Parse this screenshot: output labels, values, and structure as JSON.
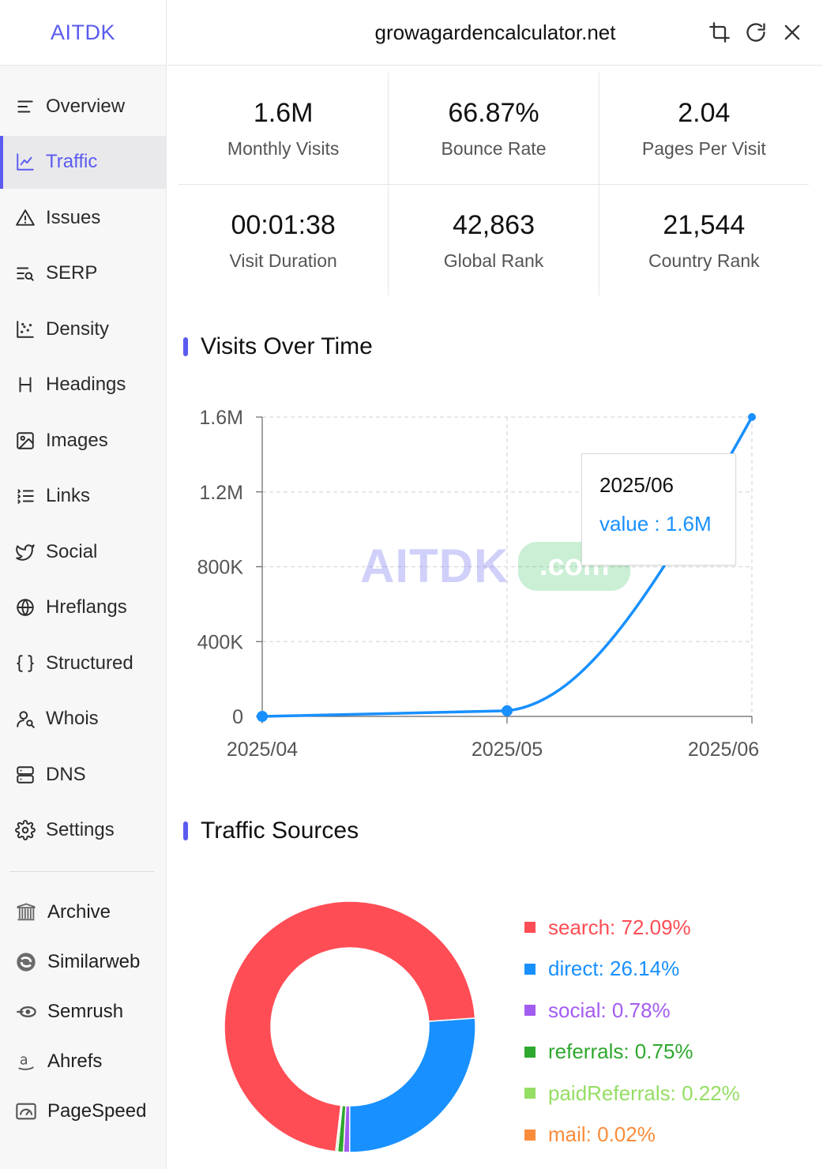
{
  "brand": "AITDK",
  "header": {
    "domain": "growagardencalculator.net"
  },
  "nav": [
    {
      "label": "Overview",
      "icon": "overview-icon"
    },
    {
      "label": "Traffic",
      "icon": "traffic-icon",
      "active": true
    },
    {
      "label": "Issues",
      "icon": "warning-icon"
    },
    {
      "label": "SERP",
      "icon": "serp-icon"
    },
    {
      "label": "Density",
      "icon": "density-icon"
    },
    {
      "label": "Headings",
      "icon": "heading-icon"
    },
    {
      "label": "Images",
      "icon": "image-icon"
    },
    {
      "label": "Links",
      "icon": "links-icon"
    },
    {
      "label": "Social",
      "icon": "twitter-icon"
    },
    {
      "label": "Hreflangs",
      "icon": "globe-icon"
    },
    {
      "label": "Structured",
      "icon": "braces-icon"
    },
    {
      "label": "Whois",
      "icon": "user-search-icon"
    },
    {
      "label": "DNS",
      "icon": "server-icon"
    },
    {
      "label": "Settings",
      "icon": "gear-icon"
    }
  ],
  "external": [
    {
      "label": "Archive",
      "icon": "archive-icon"
    },
    {
      "label": "Similarweb",
      "icon": "similarweb-icon"
    },
    {
      "label": "Semrush",
      "icon": "semrush-icon"
    },
    {
      "label": "Ahrefs",
      "icon": "ahrefs-icon"
    },
    {
      "label": "PageSpeed",
      "icon": "pagespeed-icon"
    }
  ],
  "stats": {
    "monthly_visits": {
      "value": "1.6M",
      "label": "Monthly Visits"
    },
    "bounce_rate": {
      "value": "66.87%",
      "label": "Bounce Rate"
    },
    "pages_per_visit": {
      "value": "2.04",
      "label": "Pages Per Visit"
    },
    "visit_duration": {
      "value": "00:01:38",
      "label": "Visit Duration"
    },
    "global_rank": {
      "value": "42,863",
      "label": "Global Rank"
    },
    "country_rank": {
      "value": "21,544",
      "label": "Country Rank"
    }
  },
  "sections": {
    "visits_title": "Visits Over Time",
    "sources_title": "Traffic Sources"
  },
  "tooltip": {
    "date": "2025/06",
    "value": "value : 1.6M"
  },
  "watermark": {
    "text": "AITDK",
    "suffix": ".com"
  },
  "chart_data": [
    {
      "type": "line",
      "x": [
        "2025/04",
        "2025/05",
        "2025/06"
      ],
      "series": [
        {
          "values": [
            0,
            30000,
            1600000
          ]
        }
      ],
      "ylim": [
        0,
        1600000
      ],
      "yticks": [
        0,
        400000,
        800000,
        1200000,
        1600000
      ],
      "ytick_labels": [
        "0",
        "400K",
        "800K",
        "1.2M",
        "1.6M"
      ],
      "grid": true,
      "color": "#1890ff"
    },
    {
      "type": "pie",
      "donut": true,
      "slices": [
        {
          "label": "search",
          "value": 72.09,
          "text": "search: 72.09%",
          "color": "#ff4d55"
        },
        {
          "label": "direct",
          "value": 26.14,
          "text": "direct: 26.14%",
          "color": "#1890ff"
        },
        {
          "label": "social",
          "value": 0.78,
          "text": "social: 0.78%",
          "color": "#a35cf0"
        },
        {
          "label": "referrals",
          "value": 0.75,
          "text": "referrals: 0.75%",
          "color": "#2ea82e"
        },
        {
          "label": "paidReferrals",
          "value": 0.22,
          "text": "paidReferrals: 0.22%",
          "color": "#95de64"
        },
        {
          "label": "mail",
          "value": 0.02,
          "text": "mail: 0.02%",
          "color": "#fa8c3c"
        }
      ],
      "legend_position": "right"
    }
  ]
}
